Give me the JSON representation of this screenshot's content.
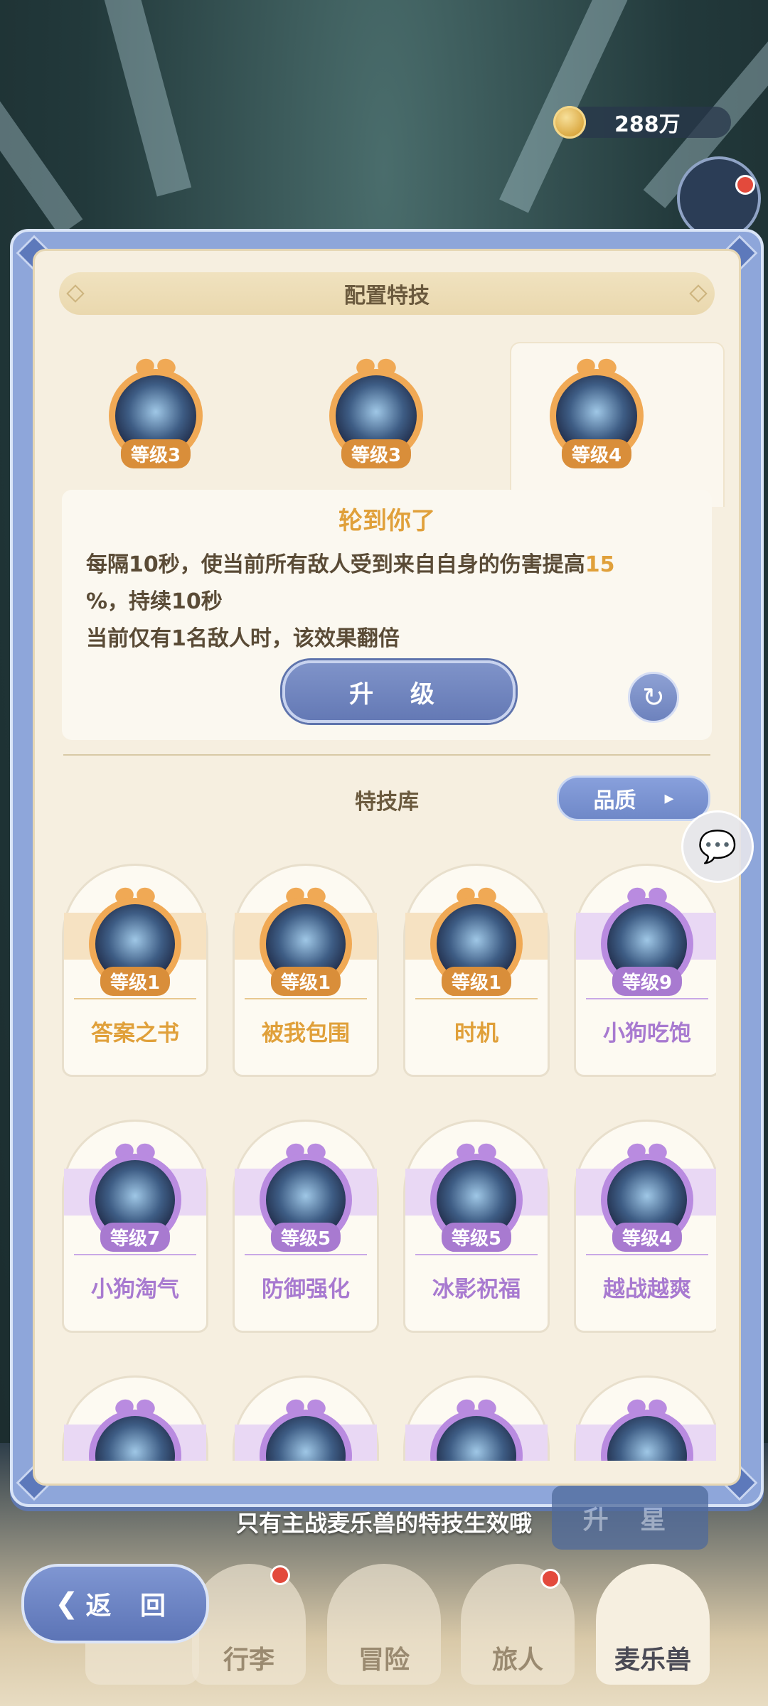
{
  "currency": {
    "amount": "288万",
    "icon": "coin-icon"
  },
  "panel": {
    "config_title": "配置特技",
    "equipped": [
      {
        "level": "等级3",
        "theme": "orange",
        "icon": "white-wolf-icon"
      },
      {
        "level": "等级3",
        "theme": "orange",
        "icon": "shadow-beast-icon"
      },
      {
        "level": "等级4",
        "theme": "orange",
        "icon": "storm-wolf-icon",
        "selected": true
      }
    ],
    "detail": {
      "title": "轮到你了",
      "line1_a": "每隔10秒，使当前所有敌人受到来自自身的伤害提高",
      "line1_hl": "15",
      "line2": "%，持续10秒",
      "line3": "当前仅有1名敌人时，该效果翻倍",
      "upgrade_label": "升 级",
      "refresh_icon": "refresh-icon"
    },
    "library_title": "特技库",
    "quality_label": "品质",
    "skills": [
      {
        "name": "答案之书",
        "level": "等级1",
        "theme": "orange"
      },
      {
        "name": "被我包围",
        "level": "等级1",
        "theme": "orange"
      },
      {
        "name": "时机",
        "level": "等级1",
        "theme": "orange"
      },
      {
        "name": "小狗吃饱",
        "level": "等级9",
        "theme": "purple"
      },
      {
        "name": "小狗淘气",
        "level": "等级7",
        "theme": "purple"
      },
      {
        "name": "防御强化",
        "level": "等级5",
        "theme": "purple"
      },
      {
        "name": "冰影祝福",
        "level": "等级5",
        "theme": "purple"
      },
      {
        "name": "越战越爽",
        "level": "等级4",
        "theme": "purple"
      },
      {
        "name": "",
        "level": "",
        "theme": "purple"
      },
      {
        "name": "",
        "level": "",
        "theme": "purple"
      },
      {
        "name": "",
        "level": "",
        "theme": "purple"
      },
      {
        "name": "",
        "level": "",
        "theme": "purple"
      }
    ]
  },
  "note": "只有主战麦乐兽的特技生效哦",
  "star_button": "升 星",
  "back_label": "返 回",
  "nav": [
    "行李",
    "冒险",
    "旅人",
    "麦乐兽"
  ],
  "colors": {
    "orange": "#e0a03a",
    "orange_ring": "#f0a955",
    "purple": "#a87ad0",
    "purple_ring": "#b98be0",
    "panel_blue": "#8ea6da"
  }
}
